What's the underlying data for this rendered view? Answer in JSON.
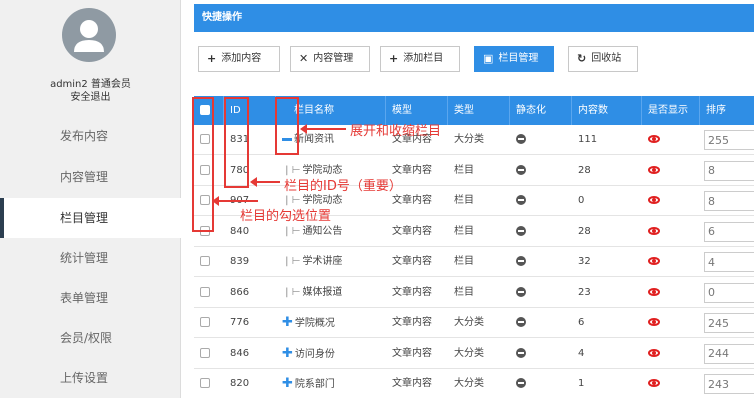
{
  "user": {
    "name": "admin2 普通会员",
    "logout": "安全退出"
  },
  "sidebar": {
    "items": [
      {
        "label": "发布内容",
        "active": false
      },
      {
        "label": "内容管理",
        "active": false
      },
      {
        "label": "栏目管理",
        "active": true
      },
      {
        "label": "统计管理",
        "active": false
      },
      {
        "label": "表单管理",
        "active": false
      },
      {
        "label": "会员/权限",
        "active": false
      },
      {
        "label": "上传设置",
        "active": false
      }
    ]
  },
  "quick_bar": {
    "title": "快捷操作"
  },
  "toolbar": {
    "add_content": "添加内容",
    "content_manage": "内容管理",
    "add_column": "添加栏目",
    "column_manage": "栏目管理",
    "recycle": "回收站"
  },
  "table": {
    "headers": [
      "ID",
      "栏目名称",
      "模型",
      "类型",
      "静态化",
      "内容数",
      "是否显示",
      "排序"
    ],
    "rows": [
      {
        "id": "831",
        "name": "新闻资讯",
        "prefix": "minus",
        "model": "文章内容",
        "type": "大分类",
        "count": "111",
        "sort": "255"
      },
      {
        "id": "780",
        "name": "学院动态",
        "prefix": "tree",
        "model": "文章内容",
        "type": "栏目",
        "count": "28",
        "sort": "8"
      },
      {
        "id": "907",
        "name": "学院动态",
        "prefix": "tree",
        "model": "文章内容",
        "type": "栏目",
        "count": "0",
        "sort": "8"
      },
      {
        "id": "840",
        "name": "通知公告",
        "prefix": "tree",
        "model": "文章内容",
        "type": "栏目",
        "count": "28",
        "sort": "6"
      },
      {
        "id": "839",
        "name": "学术讲座",
        "prefix": "tree",
        "model": "文章内容",
        "type": "栏目",
        "count": "32",
        "sort": "4"
      },
      {
        "id": "866",
        "name": "媒体报道",
        "prefix": "tree",
        "model": "文章内容",
        "type": "栏目",
        "count": "23",
        "sort": "0"
      },
      {
        "id": "776",
        "name": "学院概况",
        "prefix": "plus",
        "model": "文章内容",
        "type": "大分类",
        "count": "6",
        "sort": "245"
      },
      {
        "id": "846",
        "name": "访问身份",
        "prefix": "plus",
        "model": "文章内容",
        "type": "大分类",
        "count": "4",
        "sort": "244"
      },
      {
        "id": "820",
        "name": "院系部门",
        "prefix": "plus",
        "model": "文章内容",
        "type": "大分类",
        "count": "1",
        "sort": "243"
      }
    ]
  },
  "annotations": {
    "expand": "展开和收缩栏目",
    "id_note": "栏目的ID号（重要）",
    "checkbox_note": "栏目的勾选位置"
  },
  "colors": {
    "accent": "#2f8ee5",
    "annotation": "#e53935",
    "sidebar_bg": "#f0f0f0"
  }
}
